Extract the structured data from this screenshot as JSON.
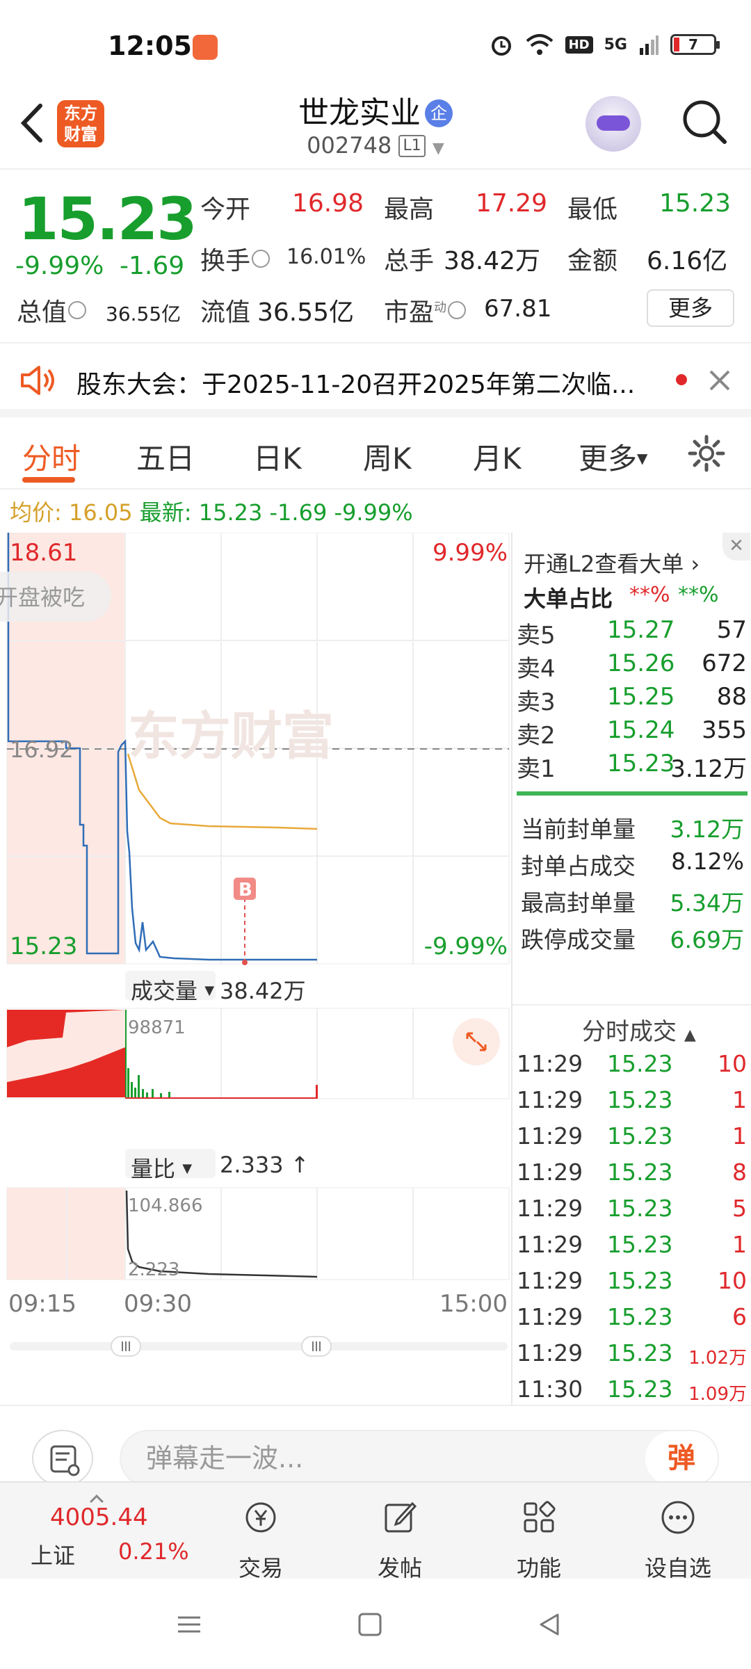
{
  "status": {
    "time": "12:05",
    "battery": "7",
    "network": "5G"
  },
  "header": {
    "stock_name": "世龙实业",
    "corp_badge": "企",
    "stock_code": "002748",
    "level_badge": "L1",
    "logo_text": "东方财富"
  },
  "quote": {
    "price": "15.23",
    "change_pct": "-9.99%",
    "change_amt": "-1.69",
    "open_label": "今开",
    "open": "16.98",
    "high_label": "最高",
    "high": "17.29",
    "low_label": "最低",
    "low": "15.23",
    "turnover_label": "换手",
    "turnover": "16.01%",
    "volume_label": "总手",
    "volume": "38.42万",
    "amount_label": "金额",
    "amount": "6.16亿",
    "mktcap_label": "总值",
    "mktcap": "36.55亿",
    "float_label": "流值",
    "float_cap": "36.55亿",
    "pe_label": "市盈",
    "pe_sup": "动",
    "pe": "67.81",
    "more_label": "更多"
  },
  "notice": {
    "text": "股东大会：于2025-11-20召开2025年第二次临..."
  },
  "tabs": [
    "分时",
    "五日",
    "日K",
    "周K",
    "月K",
    "更多"
  ],
  "avgline": {
    "avg_label": "均价:",
    "avg": "16.05",
    "latest_label": "最新:",
    "latest": "15.23",
    "chg": "-1.69",
    "pct": "-9.99%"
  },
  "chart": {
    "price_max": "18.61",
    "price_pre": "16.92",
    "price_min": "15.23",
    "pct_max": "9.99%",
    "pct_min": "-9.99%",
    "opening_tag": "开盘被吃",
    "watermark": "东方财富",
    "trade_marker": "B",
    "volume_label": "成交量",
    "volume_total": "38.42万",
    "volume_max": "98871",
    "ratio_label": "量比",
    "ratio_value": "2.333",
    "ratio_max": "104.866",
    "ratio_min": "2.223",
    "time_start": "09:15",
    "time_open": "09:30",
    "time_end": "15:00"
  },
  "rpanel": {
    "l2_banner": "开通L2查看大单",
    "big_order_label": "大单占比",
    "big_red": "**%",
    "big_green": "**%",
    "orderbook": [
      {
        "label": "卖5",
        "price": "15.27",
        "vol": "57"
      },
      {
        "label": "卖4",
        "price": "15.26",
        "vol": "672"
      },
      {
        "label": "卖3",
        "price": "15.25",
        "vol": "88"
      },
      {
        "label": "卖2",
        "price": "15.24",
        "vol": "355"
      },
      {
        "label": "卖1",
        "price": "15.23",
        "vol": "3.12万"
      }
    ],
    "stats": [
      {
        "label": "当前封单量",
        "value": "3.12万"
      },
      {
        "label": "封单占成交",
        "value": "8.12%"
      },
      {
        "label": "最高封单量",
        "value": "5.34万"
      },
      {
        "label": "跌停成交量",
        "value": "6.69万"
      }
    ],
    "trades_title": "分时成交",
    "trades": [
      {
        "time": "11:29",
        "price": "15.23",
        "vol": "10"
      },
      {
        "time": "11:29",
        "price": "15.23",
        "vol": "1"
      },
      {
        "time": "11:29",
        "price": "15.23",
        "vol": "1"
      },
      {
        "time": "11:29",
        "price": "15.23",
        "vol": "8"
      },
      {
        "time": "11:29",
        "price": "15.23",
        "vol": "5"
      },
      {
        "time": "11:29",
        "price": "15.23",
        "vol": "1"
      },
      {
        "time": "11:29",
        "price": "15.23",
        "vol": "10"
      },
      {
        "time": "11:29",
        "price": "15.23",
        "vol": "6"
      },
      {
        "time": "11:29",
        "price": "15.23",
        "vol": "1.02万"
      },
      {
        "time": "11:30",
        "price": "15.23",
        "vol": "1.09万"
      }
    ]
  },
  "comment": {
    "placeholder": "弹幕走一波...",
    "send_label": "弹"
  },
  "bottom_nav": {
    "index_value": "4005.44",
    "index_name": "上证",
    "index_pct": "0.21%",
    "items": [
      "交易",
      "发帖",
      "功能",
      "设自选"
    ]
  },
  "colors": {
    "up": "#e0282b",
    "down": "#179e2d",
    "accent": "#ee5a24"
  }
}
